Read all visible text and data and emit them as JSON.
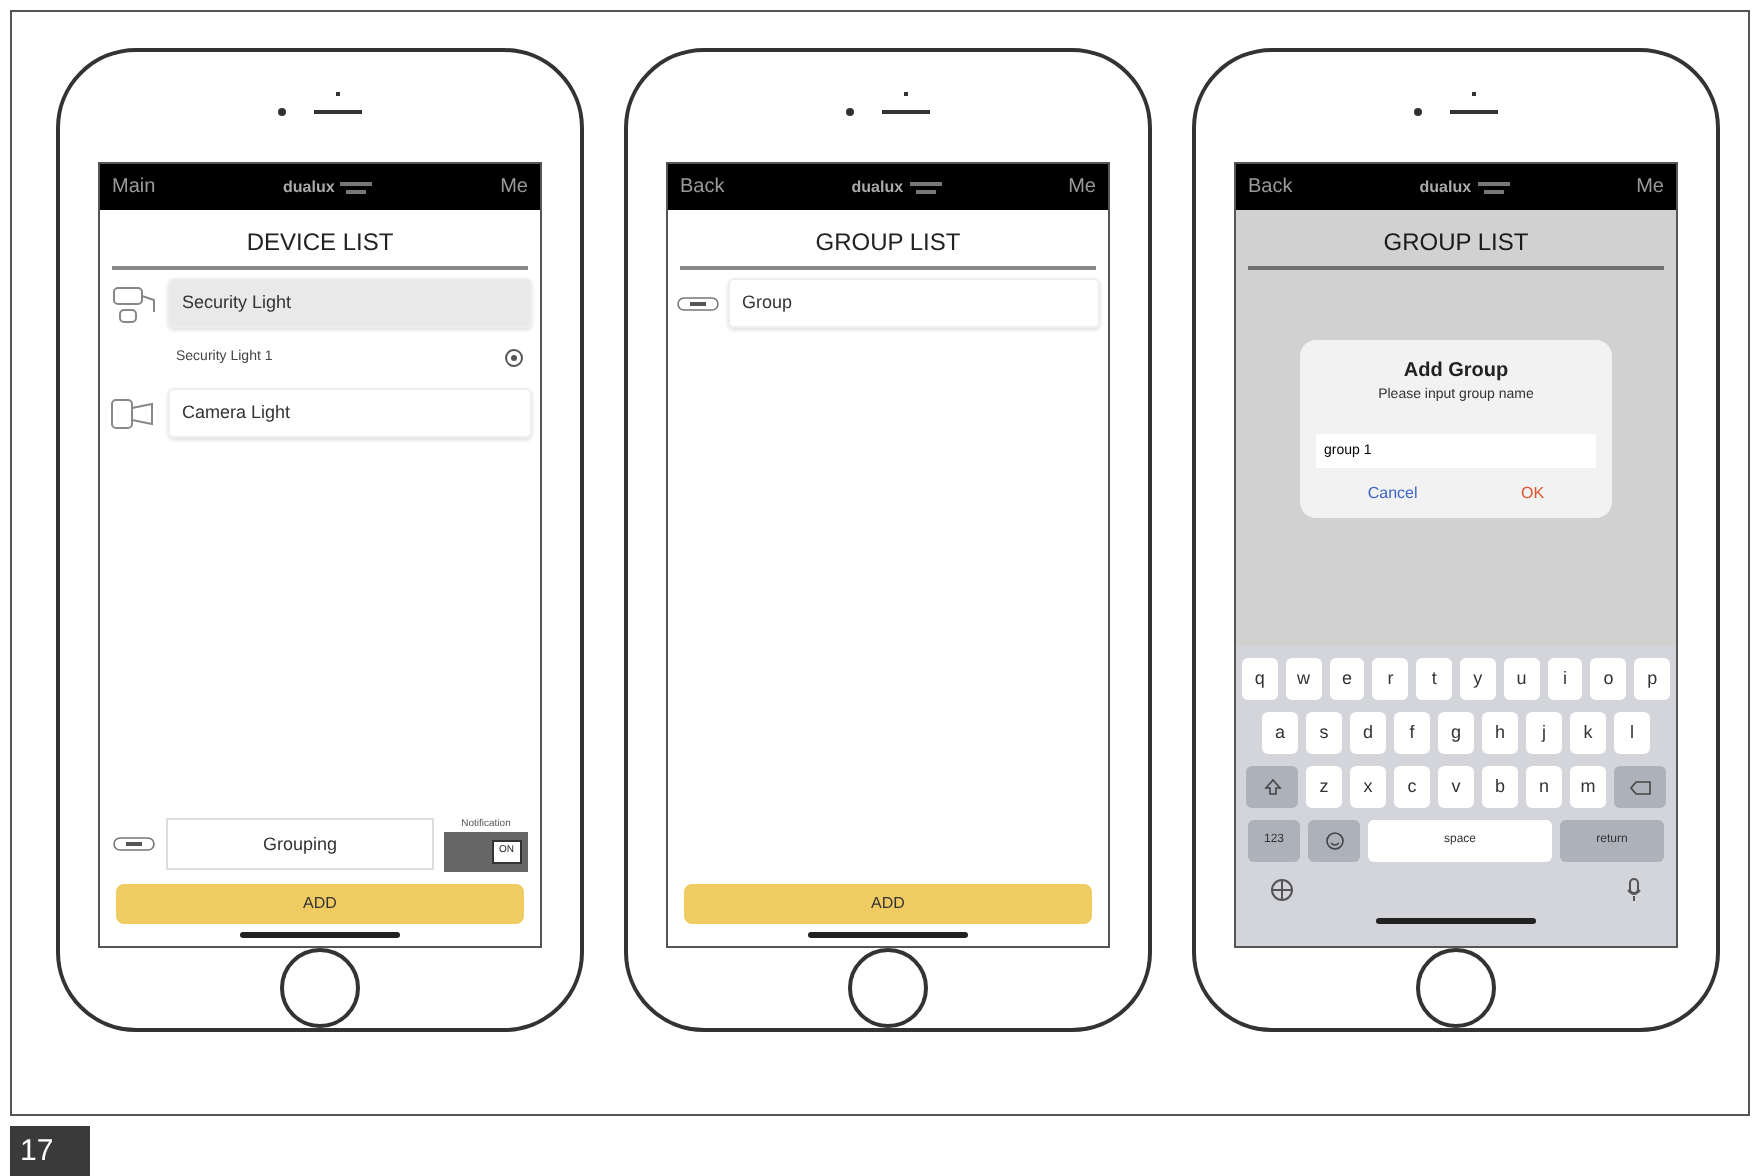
{
  "phones": [
    {
      "nav": {
        "left": "Main",
        "logo": "dualux",
        "right": "Me"
      },
      "heading": "DEVICE LIST",
      "devices": [
        {
          "name": "Security Light",
          "kind": "security",
          "selected": true,
          "children": [
            {
              "name": "Security Light 1"
            }
          ]
        },
        {
          "name": "Camera Light",
          "kind": "camera",
          "selected": false
        }
      ],
      "footer": {
        "grouping": "Grouping",
        "notification_label": "Notification",
        "toggle_text": "ON",
        "on": true
      },
      "add_button": "ADD"
    },
    {
      "nav": {
        "left": "Back",
        "logo": "dualux",
        "right": "Me"
      },
      "heading": "GROUP LIST",
      "groups": [
        {
          "name": "Group"
        }
      ],
      "add_button": "ADD"
    },
    {
      "nav": {
        "left": "Back",
        "logo": "dualux",
        "right": "Me"
      },
      "heading": "GROUP LIST",
      "dialog": {
        "title": "Add Group",
        "message": "Please input group name",
        "value": "group 1",
        "cancel": "Cancel",
        "ok": "OK"
      },
      "keyboard": {
        "rows": [
          [
            "q",
            "w",
            "e",
            "r",
            "t",
            "y",
            "u",
            "i",
            "o",
            "p"
          ],
          [
            "a",
            "s",
            "d",
            "f",
            "g",
            "h",
            "j",
            "k",
            "l"
          ],
          [
            "z",
            "x",
            "c",
            "v",
            "b",
            "n",
            "m"
          ]
        ],
        "number_key": "123",
        "space": "space",
        "return": "return"
      }
    }
  ],
  "page_number": "17"
}
